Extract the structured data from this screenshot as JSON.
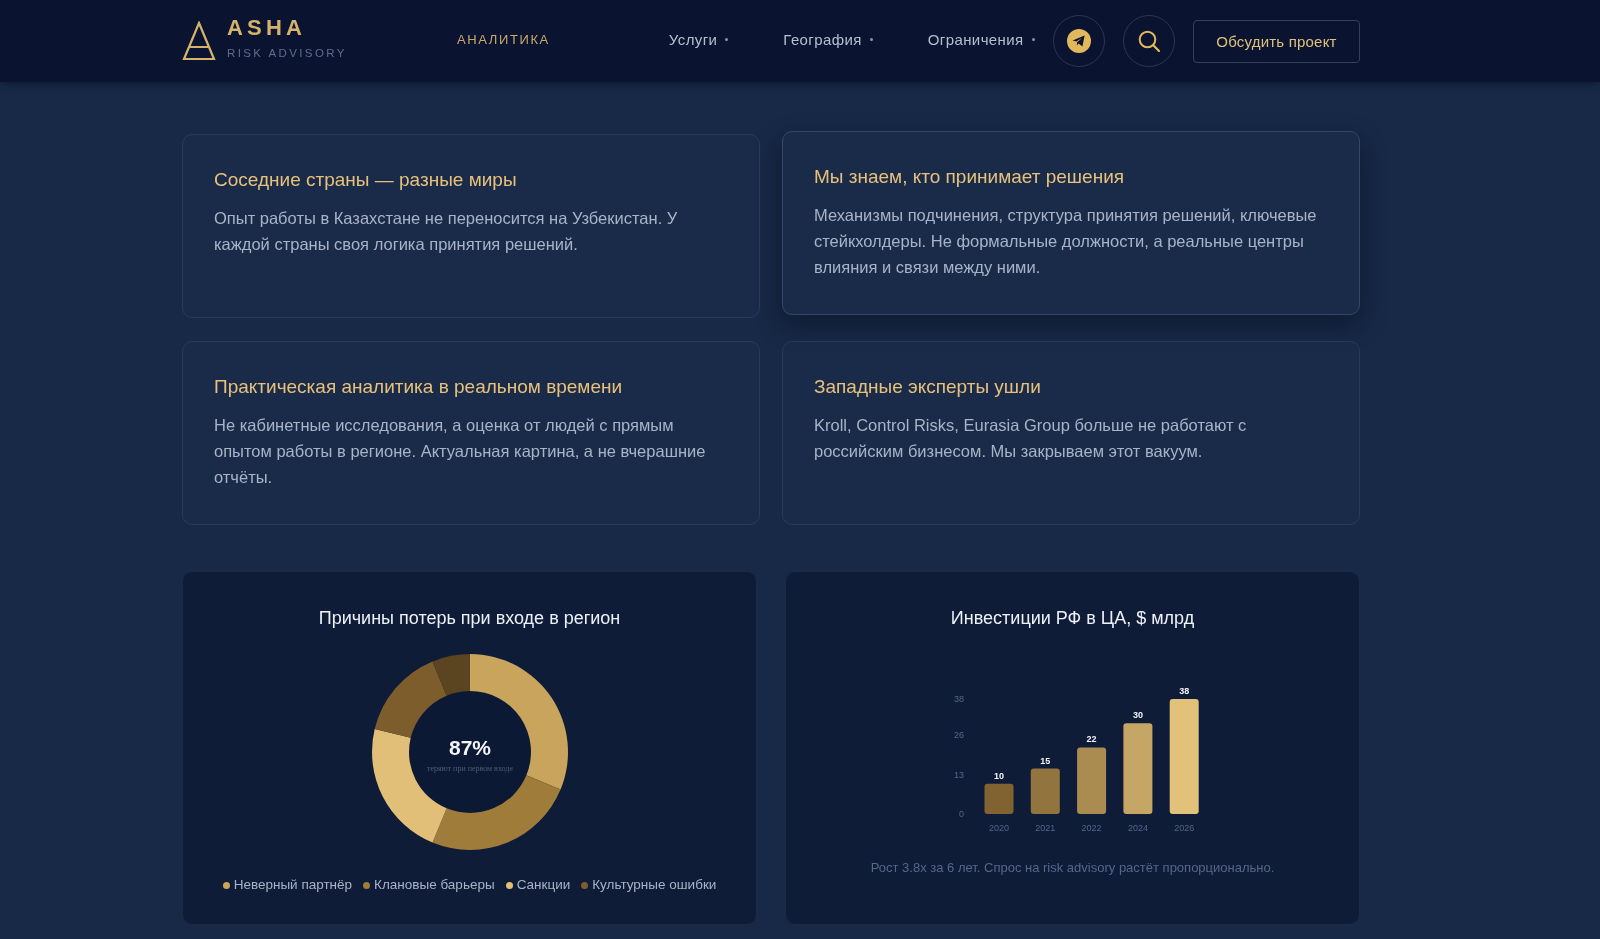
{
  "header": {
    "logo": {
      "name": "ASHA",
      "tagline": "RISK ADVISORY"
    },
    "nav": [
      {
        "label": "АНАЛИТИКА",
        "selected": true,
        "dropdown": false
      },
      {
        "label": "Услуги",
        "selected": false,
        "dropdown": true
      },
      {
        "label": "География",
        "selected": false,
        "dropdown": true
      },
      {
        "label": "Ограничения",
        "selected": false,
        "dropdown": true
      }
    ],
    "cta_button": "Обсудить проект"
  },
  "cards": [
    {
      "title": "Соседние страны — разные миры",
      "text": "Опыт работы в Казахстане не переносится на Узбекистан. У каждой страны своя логика принятия решений.",
      "raised": false
    },
    {
      "title": "Мы знаем, кто принимает решения",
      "text": "Механизмы подчинения, структура принятия решений, ключевые стейкхолдеры. Не формальные должности, а реальные центры влияния и связи между ними.",
      "raised": true
    },
    {
      "title": "Практическая аналитика в реальном времени",
      "text": "Не кабинетные исследования, а оценка от людей с прямым опытом работы в регионе. Актуальная картина, а не вчерашние отчёты.",
      "raised": false
    },
    {
      "title": "Западные эксперты ушли",
      "text": "Kroll, Control Risks, Eurasia Group больше не работают с российским бизнесом. Мы закрываем этот вакуум.",
      "raised": false
    }
  ],
  "charts": [
    {
      "chart_data": {
        "type": "donut",
        "title": "Причины потерь при входе в регион",
        "values": [
          31.25,
          25,
          22.5,
          15,
          6.25
        ],
        "colors": [
          "#c9a45c",
          "#a07c3a",
          "#e2bf78",
          "#7d5d2c",
          "#5b4420"
        ]
      },
      "center_value": "87%",
      "center_label": "теряют при первом входе",
      "legend": [
        {
          "label": "Неверный партнёр",
          "color": "#c9a45c"
        },
        {
          "label": "Клановые барьеры",
          "color": "#a07c3a"
        },
        {
          "label": "Санкции",
          "color": "#e2bf78"
        },
        {
          "label": "Культурные ошибки",
          "color": "#7d5d2c"
        }
      ]
    },
    {
      "chart_data": {
        "type": "bar",
        "title": "Инвестиции РФ в ЦА, $ млрд",
        "categories": [
          "2020",
          "2021",
          "2022",
          "2024",
          "2026"
        ],
        "values": [
          10,
          15,
          22,
          30,
          38
        ],
        "ylim": [
          0,
          38
        ],
        "yticks": [
          0,
          13,
          26,
          38
        ],
        "data_labels": true
      },
      "caption": "Рост 3.8x за 6 лет. Спрос на risk advisory растёт пропорционально."
    }
  ]
}
